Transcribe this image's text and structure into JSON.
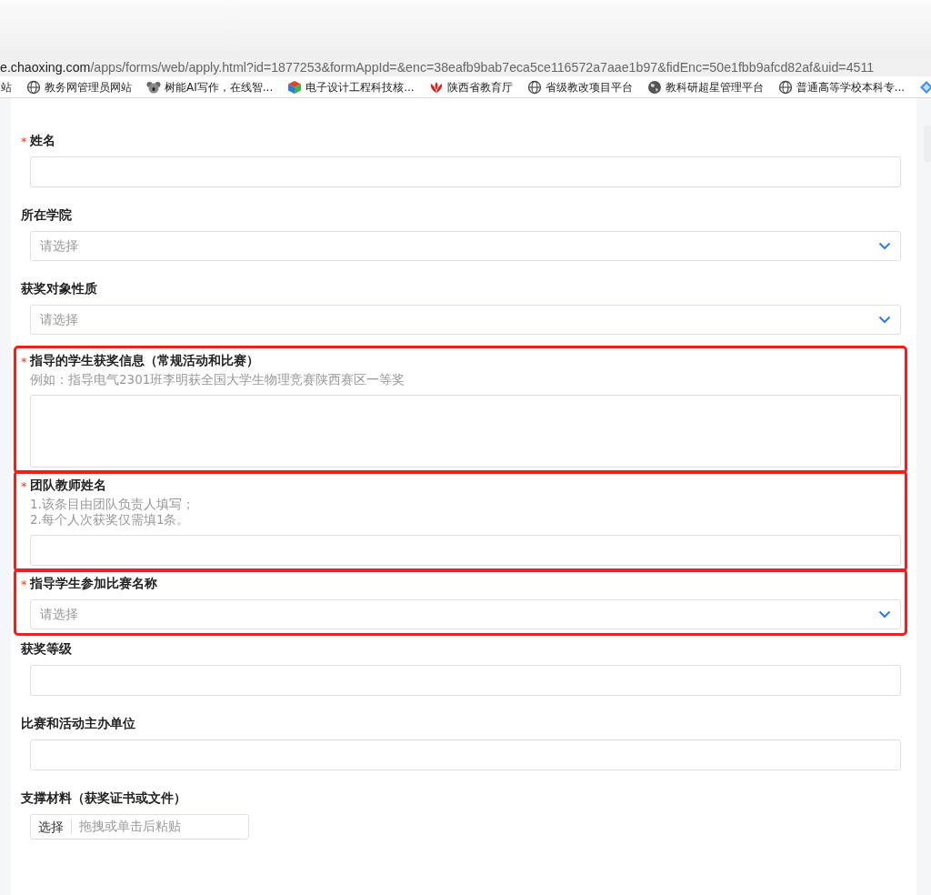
{
  "browser": {
    "url_host": "e.chaoxing.com",
    "url_path": "/apps/forms/web/apply.html?id=1877253&formAppId=&enc=38eafb9bab7eca5ce116572a7aae1b97&fidEnc=50e1fbb9afcd82af&uid=4511",
    "bookmarks": [
      {
        "kind": "plain",
        "label": "站"
      },
      {
        "kind": "globe",
        "label": "教务网管理员网站"
      },
      {
        "kind": "koala",
        "label": "树能AI写作，在线智..."
      },
      {
        "kind": "cube",
        "label": "电子设计工程科技核..."
      },
      {
        "kind": "flower",
        "label": "陕西省教育厅"
      },
      {
        "kind": "globe",
        "label": "省级教改项目平台"
      },
      {
        "kind": "earth",
        "label": "教科研超星管理平台"
      },
      {
        "kind": "globe",
        "label": "普通高等学校本科专..."
      },
      {
        "kind": "diamond"
      }
    ]
  },
  "fields": [
    {
      "kind": "text",
      "label": "姓名",
      "required": "*",
      "highlighted": false
    },
    {
      "kind": "select",
      "label": "所在学院",
      "required": false,
      "highlighted": false,
      "placeholder": "请选择"
    },
    {
      "kind": "select",
      "label": "获奖对象性质",
      "required": false,
      "highlighted": false,
      "placeholder": "请选择"
    },
    {
      "kind": "textarea",
      "label": "指导的学生获奖信息（常规活动和比赛）",
      "required": "*",
      "highlighted": true,
      "hints": [
        "例如：指导电气2301班李明获全国大学生物理竞赛陕西赛区一等奖"
      ]
    },
    {
      "kind": "text",
      "label": "团队教师姓名",
      "required": "*",
      "highlighted": true,
      "hints": [
        "1.该条目由团队负责人填写；",
        "2.每个人次获奖仅需填1条。"
      ]
    },
    {
      "kind": "select",
      "label": "指导学生参加比赛名称",
      "required": "*",
      "highlighted": true,
      "placeholder": "请选择"
    },
    {
      "kind": "text",
      "label": "获奖等级",
      "required": false,
      "highlighted": false
    },
    {
      "kind": "text",
      "label": "比赛和活动主办单位",
      "required": false,
      "highlighted": false
    },
    {
      "kind": "upload",
      "label": "支撑材料（获奖证书或文件）",
      "required": false,
      "highlighted": false,
      "button": "选择",
      "placeholder": "拖拽或单击后粘贴"
    }
  ]
}
